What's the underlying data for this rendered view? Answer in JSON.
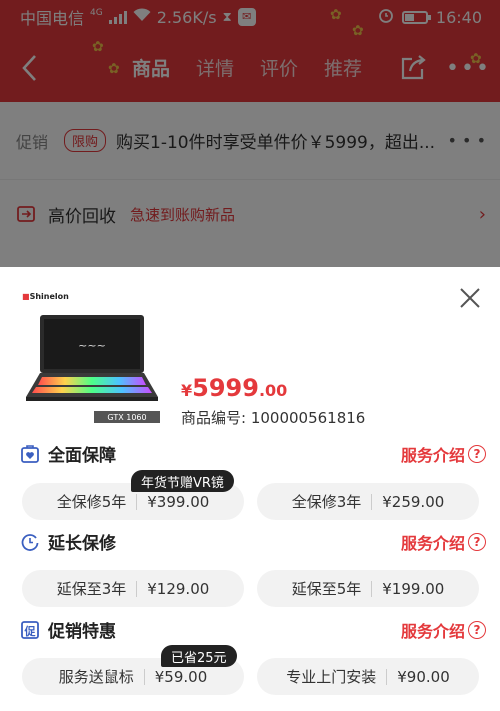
{
  "status_bar": {
    "carrier": "中国电信",
    "network": "4G",
    "speed": "2.56K/s",
    "time": "16:40"
  },
  "nav": {
    "tabs": [
      "商品",
      "详情",
      "评价",
      "推荐"
    ],
    "active_tab": "商品",
    "more_label": "•••"
  },
  "background_page": {
    "promo": {
      "label": "促销",
      "tag": "限购",
      "text": "购买1-10件时享受单件价￥5999，超出..."
    },
    "recycle": {
      "title": "高价回收",
      "subtitle": "急速到账购新品"
    }
  },
  "popup": {
    "brand": "Shinelon",
    "product_caption": "GTX 1060",
    "price": {
      "currency": "¥",
      "integer": "5999",
      "decimal": ".00"
    },
    "sku_label": "商品编号: 100000561816",
    "service_link": "服务介绍",
    "sections": [
      {
        "title": "全面保障",
        "icon": "shield-heart-icon",
        "options": [
          {
            "name": "全保修5年",
            "price": "¥399.00",
            "badge": "年货节赠VR镜"
          },
          {
            "name": "全保修3年",
            "price": "¥259.00",
            "badge": null
          }
        ]
      },
      {
        "title": "延长保修",
        "icon": "clock-arrow-icon",
        "options": [
          {
            "name": "延保至3年",
            "price": "¥129.00",
            "badge": null
          },
          {
            "name": "延保至5年",
            "price": "¥199.00",
            "badge": null
          }
        ]
      },
      {
        "title": "促销特惠",
        "icon": "promo-icon",
        "options": [
          {
            "name": "服务送鼠标",
            "price": "¥59.00",
            "badge": "已省25元"
          },
          {
            "name": "专业上门安装",
            "price": "¥90.00",
            "badge": null
          }
        ]
      }
    ]
  },
  "colors": {
    "brand_red": "#e4393c",
    "pill_bg": "#f2f2f2",
    "badge_bg": "#222222"
  }
}
